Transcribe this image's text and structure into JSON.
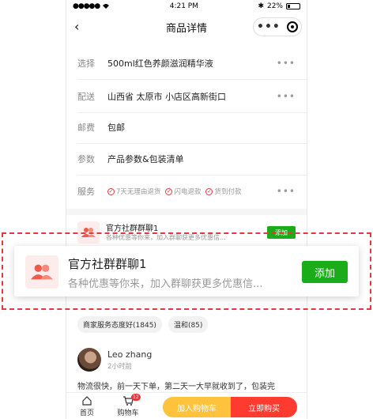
{
  "status_bar": {
    "time": "4:21 PM",
    "battery": "22%"
  },
  "nav": {
    "title": "商品详情",
    "back_icon": "chevron-left-icon"
  },
  "rows": {
    "select": {
      "label": "选择",
      "value": "500ml红色养颜滋润精华液"
    },
    "delivery": {
      "label": "配送",
      "value": "山西省 太原市 小店区高新街口"
    },
    "shipping": {
      "label": "邮费",
      "value": "包邮"
    },
    "params": {
      "label": "参数",
      "value": "产品参数&包装清单"
    },
    "service": {
      "label": "服务",
      "items": [
        "7天无理由退货",
        "闪电退款",
        "货到付款"
      ]
    }
  },
  "group": {
    "title": "官方社群群聊1",
    "desc_small": "各种优惠等你来，加入群聊获更多优惠信...",
    "desc_large": "各种优惠等你来，加入群聊获更多优惠信...",
    "add_label": "添加",
    "accent": "#1aad19"
  },
  "tags": [
    "商家服务态度好(1845)",
    "温和(85)"
  ],
  "review": {
    "name": "Leo zhang",
    "time": "2小时前",
    "text": "物流很快，前一天下单，第二天一大早就收到了，包装完"
  },
  "tabbar": {
    "home_label": "首页",
    "cart_label": "购物车",
    "cart_badge": "12",
    "add_cart_label": "加入购物车",
    "buy_label": "立即购买",
    "colors": {
      "add_cart": "#ffc23c",
      "buy": "#ff3b30"
    }
  }
}
